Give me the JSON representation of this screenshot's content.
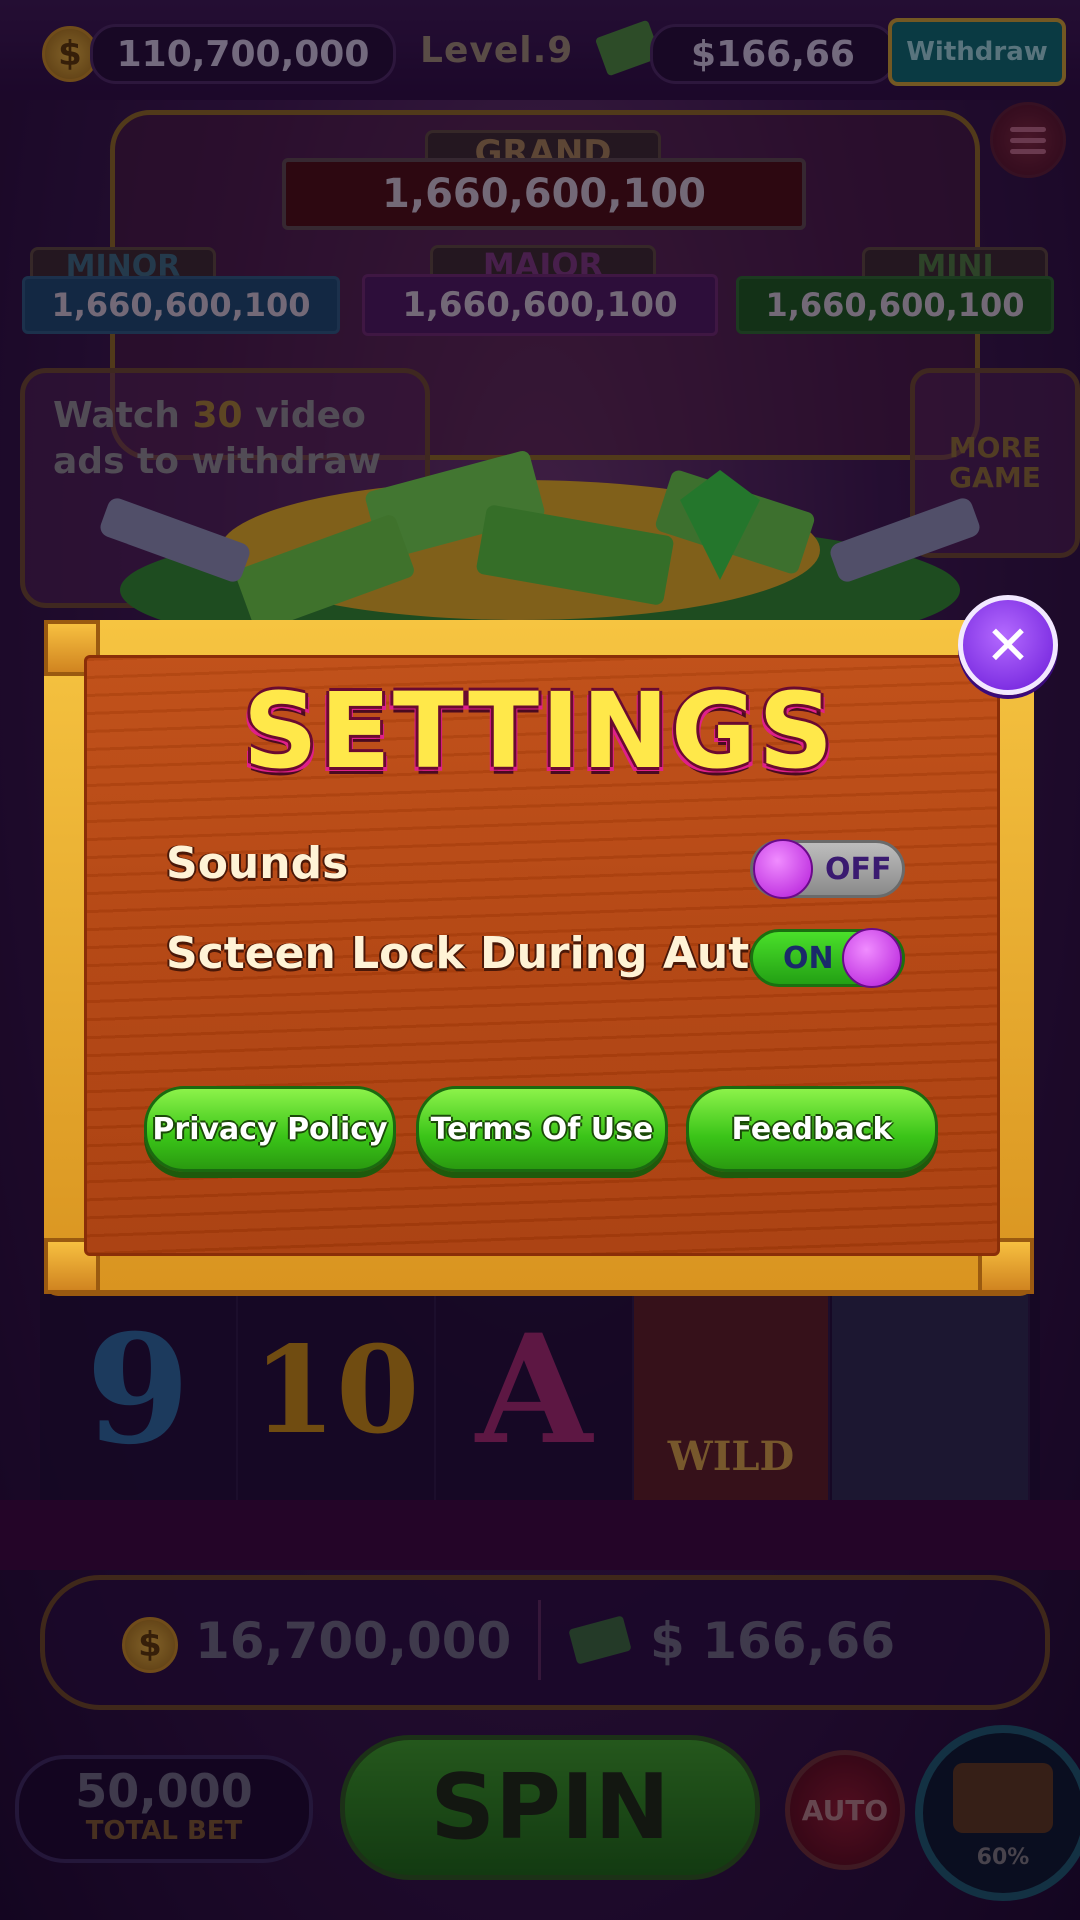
{
  "top_bar": {
    "coins": "110,700,000",
    "level_label": "Level.9",
    "cash": "$166,66",
    "withdraw_label": "Withdraw"
  },
  "jackpots": {
    "grand": {
      "label": "GRAND",
      "value": "1,660,600,100"
    },
    "minor": {
      "label": "MINOR",
      "value": "1,660,600,100"
    },
    "major": {
      "label": "MAJOR",
      "value": "1,660,600,100"
    },
    "mini": {
      "label": "MINI",
      "value": "1,660,600,100"
    }
  },
  "watch_ads": {
    "text_before": "Watch ",
    "count": "30",
    "text_after": " video ads to withdraw"
  },
  "more_game_label": "MORE GAME",
  "settings": {
    "title": "SETTINGS",
    "sounds_label": "Sounds",
    "sounds_state": "OFF",
    "screen_lock_label": "Scteen Lock During Auto",
    "screen_lock_state": "ON",
    "buttons": {
      "privacy": "Privacy Policy",
      "terms": "Terms Of Use",
      "feedback": "Feedback"
    },
    "close_symbol": "✕"
  },
  "reels": [
    "9",
    "10",
    "A",
    "WILD",
    ""
  ],
  "bottom": {
    "coins": "16,700,000",
    "cash": "$ 166,66",
    "total_bet_value": "50,000",
    "total_bet_label": "TOTAL BET",
    "spin_label": "SPIN",
    "auto_label": "AUTO",
    "chest_progress": "60%"
  },
  "colors": {
    "title_yellow": "#ffe84a",
    "wood": "#b3430f",
    "frame_gold": "#f6c441",
    "button_green": "#3ac418",
    "knob_purple": "#b21ad8"
  }
}
